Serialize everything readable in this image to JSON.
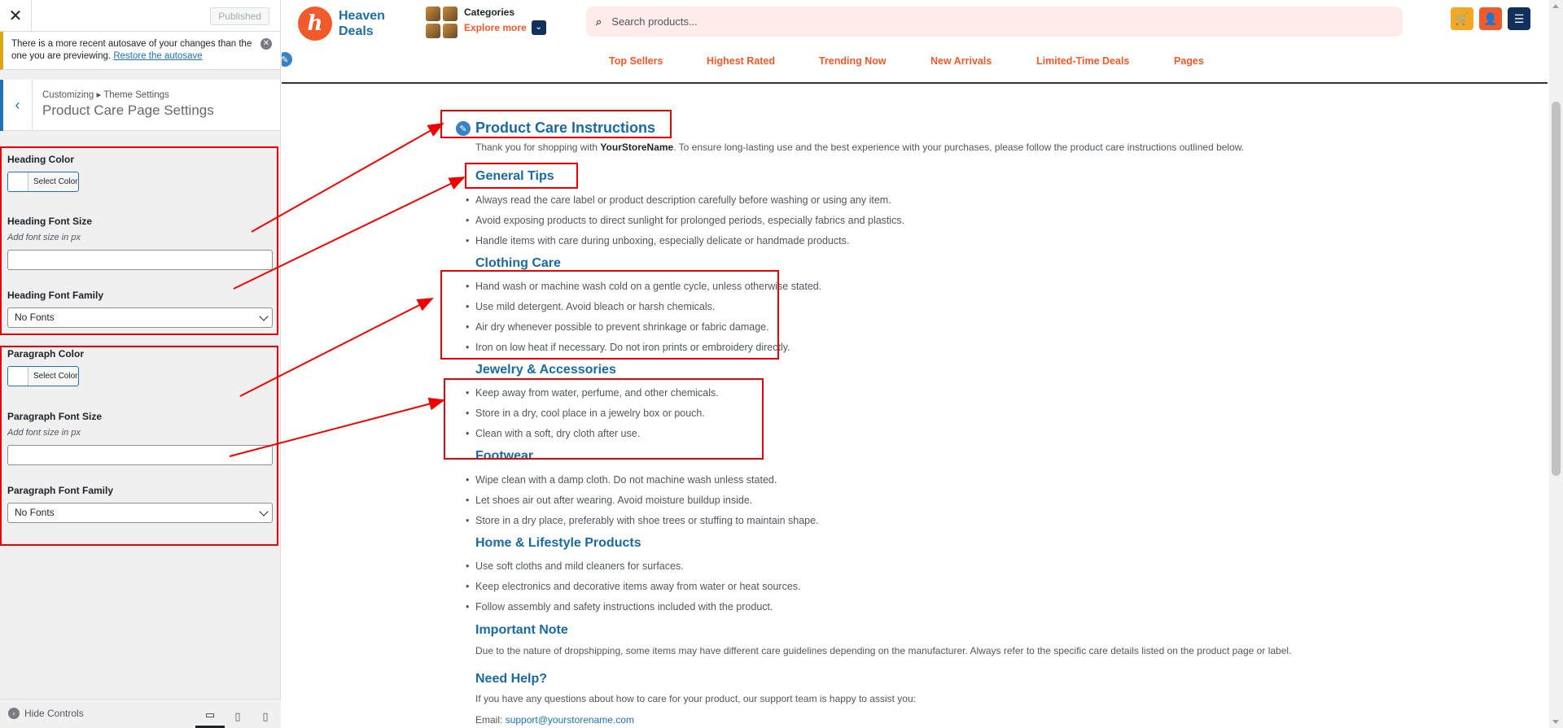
{
  "sidebar": {
    "published_label": "Published",
    "notice_text": "There is a more recent autosave of your changes than the one you are previewing.",
    "notice_link": "Restore the autosave",
    "breadcrumb": "Customizing ▸ Theme Settings",
    "section_title": "Product Care Page Settings",
    "heading_color_label": "Heading Color",
    "heading_color_btn": "Select Color",
    "heading_font_size_label": "Heading Font Size",
    "heading_font_size_desc": "Add font size in px",
    "heading_font_size_value": "",
    "heading_font_family_label": "Heading Font Family",
    "heading_font_family_value": "No Fonts",
    "paragraph_color_label": "Paragraph Color",
    "paragraph_color_btn": "Select Color",
    "paragraph_font_size_label": "Paragraph Font Size",
    "paragraph_font_size_desc": "Add font size in px",
    "paragraph_font_size_value": "",
    "paragraph_font_family_label": "Paragraph Font Family",
    "paragraph_font_family_value": "No Fonts",
    "hide_controls": "Hide Controls"
  },
  "header": {
    "logo_line1": "Heaven",
    "logo_line2": "Deals",
    "categories_title": "Categories",
    "categories_more": "Explore more",
    "search_placeholder": "Search products...",
    "nav": [
      "Top Sellers",
      "Highest Rated",
      "Trending Now",
      "New Arrivals",
      "Limited-Time Deals",
      "Pages"
    ],
    "accent_color": "#f15a2b",
    "brand_color": "#1f6ea3"
  },
  "content": {
    "title": "Product Care Instructions",
    "intro_prefix": "Thank you for shopping with ",
    "intro_store": "YourStoreName",
    "intro_suffix": ". To ensure long-lasting use and the best experience with your purchases, please follow the product care instructions outlined below.",
    "sections": [
      {
        "heading": "General Tips",
        "items": [
          "Always read the care label or product description carefully before washing or using any item.",
          "Avoid exposing products to direct sunlight for prolonged periods, especially fabrics and plastics.",
          "Handle items with care during unboxing, especially delicate or handmade products."
        ]
      },
      {
        "heading": "Clothing Care",
        "items": [
          "Hand wash or machine wash cold on a gentle cycle, unless otherwise stated.",
          "Use mild detergent. Avoid bleach or harsh chemicals.",
          "Air dry whenever possible to prevent shrinkage or fabric damage.",
          "Iron on low heat if necessary. Do not iron prints or embroidery directly."
        ]
      },
      {
        "heading": "Jewelry & Accessories",
        "items": [
          "Keep away from water, perfume, and other chemicals.",
          "Store in a dry, cool place in a jewelry box or pouch.",
          "Clean with a soft, dry cloth after use."
        ]
      },
      {
        "heading": "Footwear",
        "items": [
          "Wipe clean with a damp cloth. Do not machine wash unless stated.",
          "Let shoes air out after wearing. Avoid moisture buildup inside.",
          "Store in a dry place, preferably with shoe trees or stuffing to maintain shape."
        ]
      },
      {
        "heading": "Home & Lifestyle Products",
        "items": [
          "Use soft cloths and mild cleaners for surfaces.",
          "Keep electronics and decorative items away from water or heat sources.",
          "Follow assembly and safety instructions included with the product."
        ]
      }
    ],
    "important_heading": "Important Note",
    "important_text": "Due to the nature of dropshipping, some items may have different care guidelines depending on the manufacturer. Always refer to the specific care details listed on the product page or label.",
    "help_heading": "Need Help?",
    "help_text": "If you have any questions about how to care for your product, our support team is happy to assist you:",
    "email_label": "Email: ",
    "email_value": "support@yourstorename.com"
  }
}
